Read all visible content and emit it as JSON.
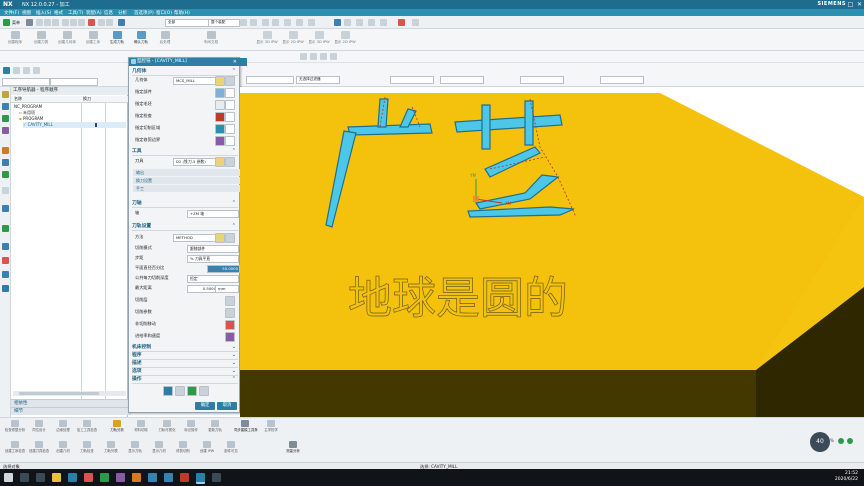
{
  "titlebar": {
    "logo": "NX",
    "title": "NX 12.0.0.27 - 加工",
    "brand": "SIEMENS",
    "min": "–",
    "max": "□",
    "close": "✕"
  },
  "menubar": {
    "items": [
      "文件(F)",
      "视图",
      "插入(S)",
      "格式",
      "工具(T)",
      "装配(A)",
      "信息",
      "分析",
      "首选项(P)",
      "窗口(O)",
      "帮助(H)"
    ]
  },
  "quickbar": {
    "menu_label": "菜单",
    "search_placeholder": "全部",
    "filter_label": "整个装配"
  },
  "ribbon": {
    "buttons": [
      "创建程序",
      "创建刀具",
      "创建几何体",
      "创建工序",
      "生成刀轨",
      "确认刀轨",
      "后处理",
      "车间文档",
      "显示 3D IPW",
      "显示 2D IPW",
      "显示 3D IPW",
      "显示 2D IPW"
    ]
  },
  "bar3": {
    "combos": [
      "",
      "",
      "",
      "无选择过滤器",
      "",
      "",
      "",
      ""
    ]
  },
  "navigator": {
    "header": "工序导航器 - 程序顺序",
    "col_name": "名称",
    "col_path": "换刀",
    "rows": [
      {
        "label": "NC_PROGRAM",
        "indent": 0
      },
      {
        "label": "未用项",
        "indent": 1
      },
      {
        "label": "PROGRAM",
        "indent": 1
      },
      {
        "label": "CAVITY_MILL",
        "indent": 2
      }
    ],
    "footers": [
      "相依性",
      "细节"
    ]
  },
  "dialog": {
    "title": "型腔铣 - [CAVITY_MILL]",
    "geometry": {
      "section": "几何体",
      "label": "几何体",
      "value": "MCS_MILL",
      "rows": [
        "指定部件",
        "指定毛坯",
        "指定检查",
        "指定切削区域",
        "指定修剪边界"
      ]
    },
    "tool": {
      "section": "工具",
      "label": "刀具",
      "value": "D2 (铣刀-5 参数)",
      "subs": [
        "输出",
        "换刀设置",
        "手工"
      ]
    },
    "axis": {
      "section": "刀轴",
      "label": "轴",
      "value": "+ZM 轴"
    },
    "path": {
      "section": "刀轨设置",
      "method_label": "方法",
      "method_value": "METHOD",
      "cut_mode_label": "切削模式",
      "cut_mode_value": "跟随部件",
      "step_label": "步距",
      "step_value": "% 刀具平直",
      "percent_label": "平面直径百分比",
      "percent_value": "50.0000",
      "depth_label": "公共每刀切削深度",
      "depth_value": "恒定",
      "max_label": "最大距离",
      "max_value": "0.5000",
      "max_unit": "mm",
      "rows": [
        "切削层",
        "切削参数",
        "非切削移动",
        "进给率和速度"
      ]
    },
    "collapsed": [
      "机床控制",
      "程序",
      "描述",
      "选项",
      "操作"
    ],
    "ok": "确定",
    "cancel": "取消"
  },
  "viewport": {
    "engraving": "地球是圆的",
    "model_text": "广艺",
    "axis_labels": [
      "YM",
      "XM"
    ]
  },
  "bottom": {
    "row1": [
      "检查修整分析",
      "同位设计",
      "边缘处理",
      "加工工具检查",
      "刀轨分析",
      "材料切除",
      "刀轨可视化",
      "标记操作",
      "更新刀轨",
      "同步建模工具条",
      "主学校学"
    ],
    "row2": [
      "创建工序检查",
      "创建刀具检查",
      "创建几何",
      "刀轨检查",
      "刀轨列表",
      "显示刀轨",
      "显示几何",
      "修剪切削",
      "创建 IPW",
      "部件可见",
      "测量分析"
    ]
  },
  "status": {
    "left": "选择对象",
    "center": "选择: CAVITY_MILL"
  },
  "zoom": {
    "value": "40",
    "unit": "%"
  },
  "clock": {
    "time": "21:52",
    "date": "2020/6/22"
  },
  "colors": {
    "title": "#1f6d8e",
    "menu": "#2b8fb0",
    "block": "#f4c20d",
    "block_side": "#3a3200",
    "text_path": "#4cc7e8"
  }
}
